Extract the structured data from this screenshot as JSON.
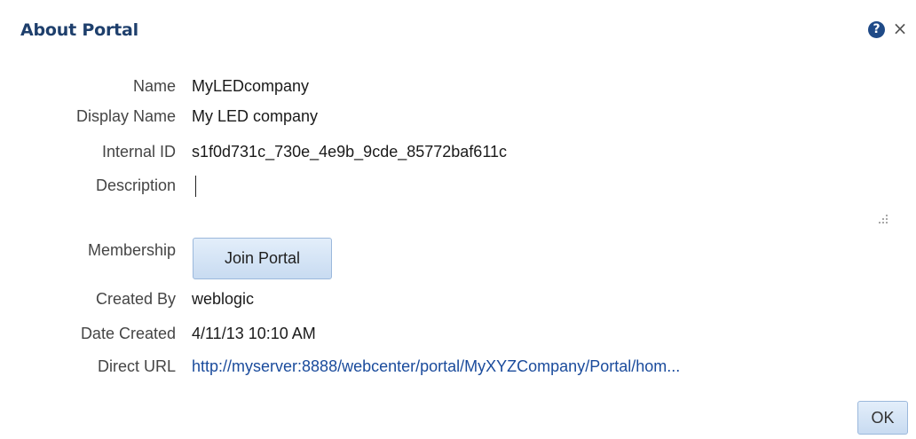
{
  "dialog": {
    "title": "About Portal",
    "help_icon_glyph": "?",
    "close_icon_glyph": "×"
  },
  "fields": {
    "name": {
      "label": "Name",
      "value": "MyLEDcompany"
    },
    "display_name": {
      "label": "Display Name",
      "value": "My LED company"
    },
    "internal_id": {
      "label": "Internal ID",
      "value": "s1f0d731c_730e_4e9b_9cde_85772baf611c"
    },
    "description": {
      "label": "Description",
      "value": ""
    },
    "membership": {
      "label": "Membership",
      "button_label": "Join Portal"
    },
    "created_by": {
      "label": "Created By",
      "value": "weblogic"
    },
    "date_created": {
      "label": "Date Created",
      "value": "4/11/13 10:10 AM"
    },
    "direct_url": {
      "label": "Direct URL",
      "value": "http://myserver:8888/webcenter/portal/MyXYZCompany/Portal/hom..."
    }
  },
  "footer": {
    "ok_label": "OK"
  },
  "icons": {
    "help": "help-icon",
    "close": "close-icon",
    "resize": "resize-grip-icon"
  },
  "colors": {
    "title": "#1e3f6c",
    "link": "#1a4b9c",
    "button_bg": "#d6e5f6",
    "button_border": "#9bb8dc",
    "help_icon_bg": "#1f4a87"
  }
}
